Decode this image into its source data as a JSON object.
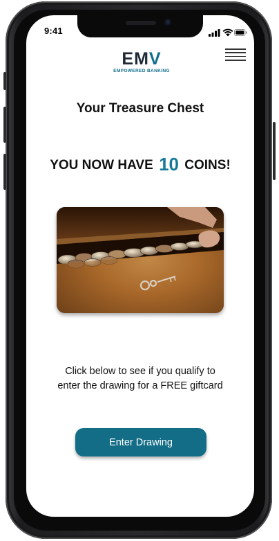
{
  "status_bar": {
    "time": "9:41"
  },
  "header": {
    "logo_text": "EM",
    "logo_accent": "V",
    "logo_tagline": "EMPOWERED BANKING",
    "menu_icon": "hamburger-menu-icon"
  },
  "main": {
    "title": "Your Treasure Chest",
    "coins_prefix": "YOU NOW HAVE",
    "coins_count": "10",
    "coins_suffix": "COINS!",
    "image_subject": "treasure-chest-with-coins",
    "instructions_line1": "Click below to see if you qualify to",
    "instructions_line2": "enter the drawing for a FREE giftcard",
    "enter_button_label": "Enter Drawing"
  },
  "colors": {
    "accent": "#157a99",
    "button": "#136d87",
    "logo_dark": "#1f2a36",
    "text": "#111111",
    "background": "#ffffff"
  }
}
